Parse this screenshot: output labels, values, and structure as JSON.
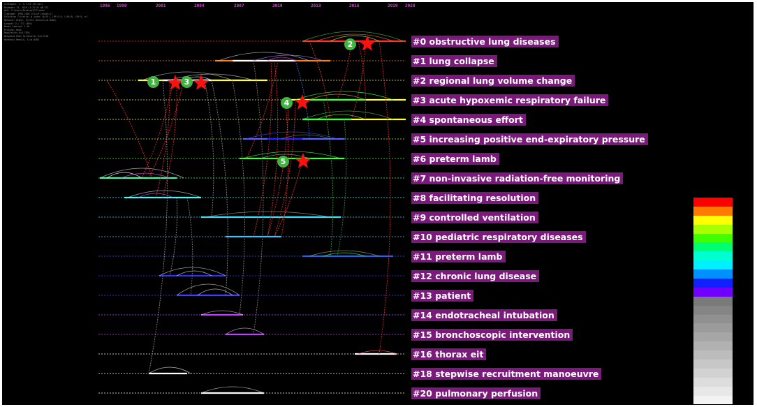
{
  "years": [
    "1996",
    "1998",
    "2001",
    "2004",
    "2007",
    "2010",
    "2013",
    "2016",
    "2019",
    "2020"
  ],
  "meta_lines": [
    "CiteSpace, v. 5.7.R2 (64-bit)",
    "December 14, 2020 11:24:52 AM CST",
    "WoS: C:\\Users\\Desktop\\EIT\\data",
    "Timespan: 1996-2020 (Slice Length=1)",
    "Selection Criteria: g-index (k=25), LRF=3.0, L/N=10, LBY=5, e=1.0",
    "Network: N=812, E=2714 (Density=0.0082)",
    "Largest CC: 717 (88%)",
    "Nodes Labeled: 1.0%",
    "Pruning: None",
    "Modularity Q=0.7935",
    "Weighted Mean Silhouette S=0.9118",
    "Harmonic Mean(Q, S)=0.8485"
  ],
  "clusters": [
    {
      "label": "#0 obstructive lung diseases",
      "line_color": "#ff3030"
    },
    {
      "label": "#1 lung collapse",
      "line_color": "#ff8020"
    },
    {
      "label": "#2 regional lung volume change",
      "line_color": "#ffff40"
    },
    {
      "label": "#3 acute hypoxemic respiratory failure",
      "line_color": "#ffff40"
    },
    {
      "label": "#4 spontaneous effort",
      "line_color": "#ffff40"
    },
    {
      "label": "#5 increasing positive end-expiratory pressure",
      "line_color": "#a0ff40"
    },
    {
      "label": "#6 preterm lamb",
      "line_color": "#40ff40"
    },
    {
      "label": "#7 non-invasive radiation-free monitoring",
      "line_color": "#40ffa0"
    },
    {
      "label": "#8 facilitating resolution",
      "line_color": "#40ffff"
    },
    {
      "label": "#9 controlled ventilation",
      "line_color": "#40e0ff"
    },
    {
      "label": "#10 pediatric respiratory diseases",
      "line_color": "#40c0ff"
    },
    {
      "label": "#11 preterm lamb",
      "line_color": "#2060ff"
    },
    {
      "label": "#12 chronic lung disease",
      "line_color": "#3030ff"
    },
    {
      "label": "#13 patient",
      "line_color": "#4040ff"
    },
    {
      "label": "#14 endotracheal intubation",
      "line_color": "#c040ff"
    },
    {
      "label": "#15 bronchoscopic intervention",
      "line_color": "#c040ff"
    },
    {
      "label": "#16 thorax eit",
      "line_color": "#ffffff"
    },
    {
      "label": "#18 stepwise recruitment manoeuvre",
      "line_color": "#ffffff"
    },
    {
      "label": "#20 pulmonary perfusion",
      "line_color": "#ffffff"
    }
  ],
  "markers": [
    {
      "number": "1"
    },
    {
      "number": "2"
    },
    {
      "number": "3"
    },
    {
      "number": "4"
    },
    {
      "number": "5"
    }
  ],
  "legend_colors": [
    "#ff0000",
    "#ff7a00",
    "#ffff00",
    "#a8ff00",
    "#40ff00",
    "#00ff70",
    "#00ffd0",
    "#00f0ff",
    "#0090ff",
    "#1020ff",
    "#7000ff",
    "#7a7a7a",
    "#858585",
    "#909090",
    "#9b9b9b",
    "#a6a6a6",
    "#b1b1b1",
    "#bcbcbc",
    "#c7c7c7",
    "#d2d2d2",
    "#dddddd",
    "#e8e8e8",
    "#f3f3f3"
  ],
  "colors": {
    "background": "#000000",
    "label_bg": "#7a1a7a",
    "star": "#ff1010",
    "marker": "#3fb43f",
    "citation_arc": "#ff3030"
  }
}
